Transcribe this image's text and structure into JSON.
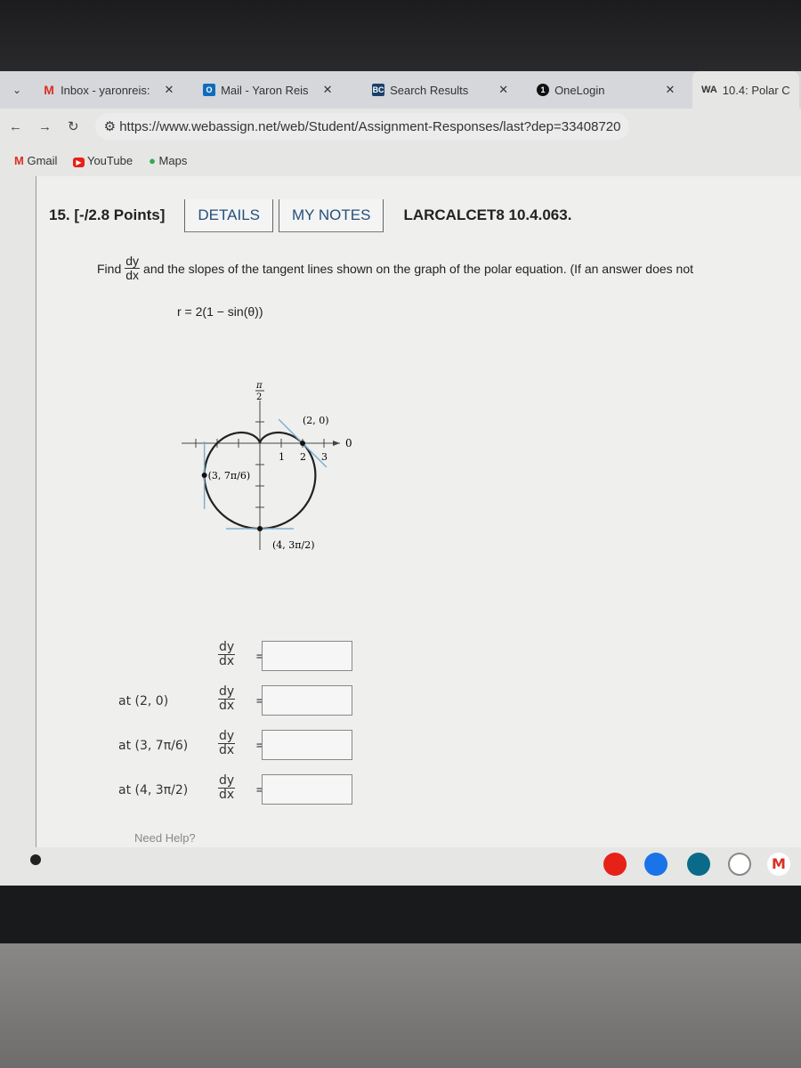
{
  "browser": {
    "tabs": [
      {
        "label": "Inbox - yaronreis:",
        "icon": "gmail-icon",
        "color": "#d93025"
      },
      {
        "label": "Mail - Yaron Reis",
        "icon": "outlook-icon",
        "color": "#0f6cbd"
      },
      {
        "label": "Search Results",
        "icon": "bc-icon",
        "color": "#1b3f6b",
        "badge": "BC"
      },
      {
        "label": "OneLogin",
        "icon": "onelogin-icon",
        "color": "#111",
        "badge": "1"
      },
      {
        "label": "10.4: Polar C",
        "icon": "webassign-icon",
        "color": "#333"
      }
    ],
    "url": "https://www.webassign.net/web/Student/Assignment-Responses/last?dep=33408720",
    "bookmarks": [
      {
        "label": "Gmail"
      },
      {
        "label": "YouTube"
      },
      {
        "label": "Maps"
      }
    ]
  },
  "question": {
    "number": "15.",
    "points": "[-/2.8 Points]",
    "details_label": "DETAILS",
    "notes_label": "MY NOTES",
    "id": "LARCALCET8 10.4.063.",
    "find": "Find",
    "dy": "dy",
    "dx": "dx",
    "prompt_rest": "and the slopes of the tangent lines shown on the graph of the polar equation. (If an answer does not",
    "equation": "r = 2(1 − sin(θ))",
    "graph": {
      "axis_top_label_num": "π",
      "axis_top_label_den": "2",
      "axis_right_label": "0",
      "tick_labels": [
        "1",
        "2",
        "3"
      ],
      "points": [
        {
          "label": "(2, 0)",
          "r": 2,
          "theta_deg": 0
        },
        {
          "label": "(3, 7π/6)",
          "r": 3,
          "theta_deg": 210
        },
        {
          "label": "(4, 3π/2)",
          "r": 4,
          "theta_deg": 270
        }
      ],
      "curve_color": "#222",
      "tangent_color": "#7fb0d0"
    },
    "answers": [
      {
        "at": "",
        "value": ""
      },
      {
        "at": "at (2, 0)",
        "value": ""
      },
      {
        "at": "at (3, 7π/6)",
        "value": ""
      },
      {
        "at": "at (4, 3π/2)",
        "value": ""
      }
    ],
    "need_help": "Need Help?"
  }
}
